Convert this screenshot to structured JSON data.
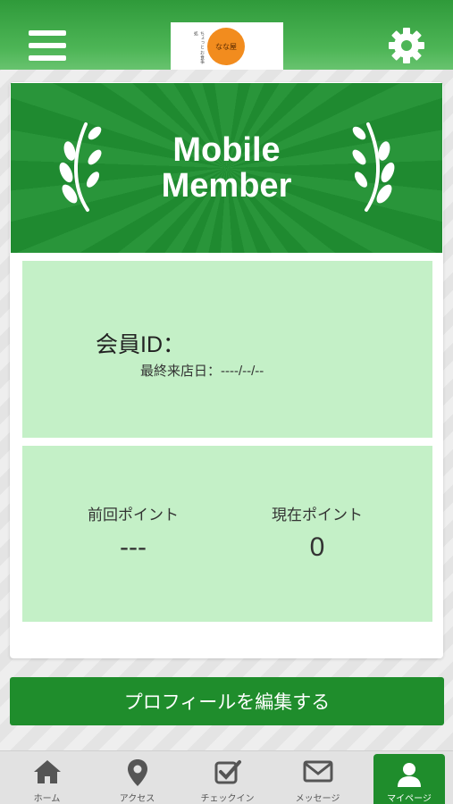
{
  "header": {
    "logo_text": "なな屋",
    "logo_subtext": "ちょっと お食事処",
    "menu_icon": "hamburger-menu-icon",
    "settings_icon": "gear-icon"
  },
  "banner": {
    "title_line1": "Mobile",
    "title_line2": "Member",
    "decoration_icon": "laurel-icon"
  },
  "member": {
    "id_label": "会員ID：",
    "last_visit": "最終来店日：----/--/--"
  },
  "points": {
    "previous_label": "前回ポイント",
    "previous_value": "---",
    "current_label": "現在ポイント",
    "current_value": "0"
  },
  "edit_profile_label": "プロフィールを編集する",
  "nav": {
    "items": [
      {
        "label": "ホーム",
        "icon": "home-icon"
      },
      {
        "label": "アクセス",
        "icon": "map-pin-icon"
      },
      {
        "label": "チェックイン",
        "icon": "checkbox-icon"
      },
      {
        "label": "メッセージ",
        "icon": "envelope-icon"
      },
      {
        "label": "マイページ",
        "icon": "user-icon",
        "active": true
      }
    ]
  },
  "colors": {
    "brand_green": "#1f8d2c",
    "panel_green": "#c4f0c7",
    "logo_orange": "#f28c1e"
  }
}
